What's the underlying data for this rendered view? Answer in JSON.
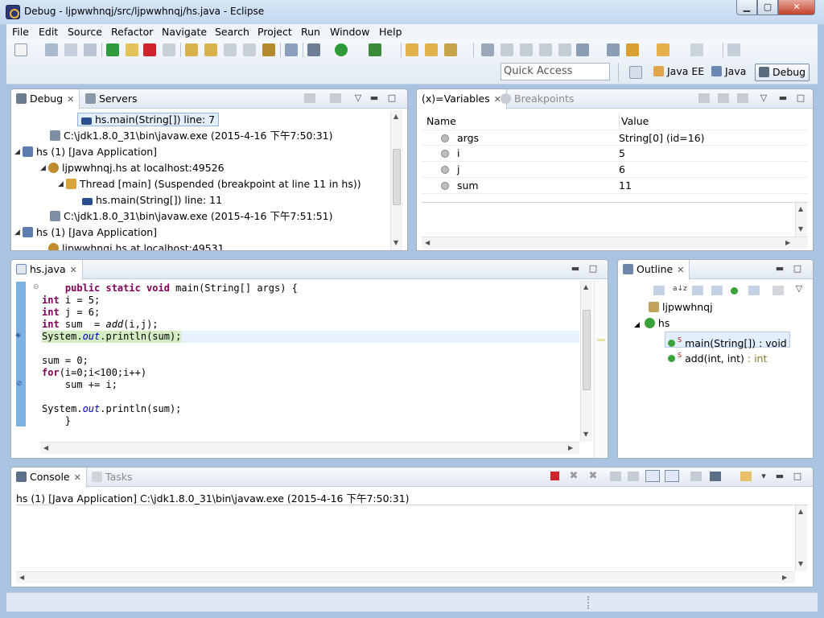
{
  "window": {
    "title": "Debug - ljpwwhnqj/src/ljpwwhnqj/hs.java - Eclipse"
  },
  "menu": [
    "File",
    "Edit",
    "Source",
    "Refactor",
    "Navigate",
    "Search",
    "Project",
    "Run",
    "Window",
    "Help"
  ],
  "toolbar": {
    "quick_access_placeholder": "Quick Access",
    "perspectives": [
      "Java EE",
      "Java",
      "Debug"
    ],
    "active_perspective": "Debug"
  },
  "debug_view": {
    "tabs": [
      "Debug",
      "Servers"
    ],
    "rows": [
      {
        "text": "hs.main(String[]) line: 7",
        "icon": "stack-frame-icon"
      },
      {
        "text": "C:\\jdk1.8.0_31\\bin\\javaw.exe (2015-4-16 下午7:50:31)",
        "icon": "process-icon"
      },
      {
        "text": "hs (1) [Java Application]",
        "icon": "java-app-icon"
      },
      {
        "text": "ljpwwhnqj.hs at localhost:49526",
        "icon": "debug-target-icon"
      },
      {
        "text": "Thread [main] (Suspended (breakpoint at line 11 in hs))",
        "icon": "thread-suspended-icon"
      },
      {
        "text": "hs.main(String[]) line: 11",
        "icon": "stack-frame-icon"
      },
      {
        "text": "C:\\jdk1.8.0_31\\bin\\javaw.exe (2015-4-16 下午7:51:51)",
        "icon": "process-icon"
      },
      {
        "text": "hs (1) [Java Application]",
        "icon": "java-app-icon"
      },
      {
        "text": "ljpwwhnqj.hs at localhost:49531",
        "icon": "debug-target-icon"
      }
    ]
  },
  "variables_view": {
    "tabs": [
      "Variables",
      "Breakpoints"
    ],
    "tab_prefix": "(x)=",
    "columns": [
      "Name",
      "Value"
    ],
    "rows": [
      {
        "name": "args",
        "value": "String[0]  (id=16)"
      },
      {
        "name": "i",
        "value": "5"
      },
      {
        "name": "j",
        "value": "6"
      },
      {
        "name": "sum",
        "value": "11"
      }
    ]
  },
  "editor": {
    "tab": "hs.java",
    "lines": [
      "    public static void main(String[] args) {",
      "int i = 5;",
      "int j = 6;",
      "int sum  = add(i,j);",
      "System.out.println(sum);",
      "",
      "sum = 0;",
      "for(i=0;i<100;i++)",
      "    sum += i;",
      "",
      "System.out.println(sum);",
      "    }"
    ],
    "current_line_index": 4
  },
  "outline_view": {
    "tab": "Outline",
    "items": [
      {
        "text": "ljpwwhnqj",
        "icon": "package-icon"
      },
      {
        "text": "hs",
        "icon": "class-icon"
      },
      {
        "text": "main(String[]) : void",
        "icon": "public-static-method-icon"
      },
      {
        "text": "add(int, int)",
        "suffix": " : int",
        "icon": "public-static-method-icon"
      }
    ]
  },
  "console_view": {
    "tabs": [
      "Console",
      "Tasks"
    ],
    "header": "hs (1) [Java Application] C:\\jdk1.8.0_31\\bin\\javaw.exe (2015-4-16 下午7:50:31)"
  },
  "colors": {
    "keyword": "#7f0055",
    "current_line": "#d4ecc4",
    "accent": "#3399ff"
  }
}
